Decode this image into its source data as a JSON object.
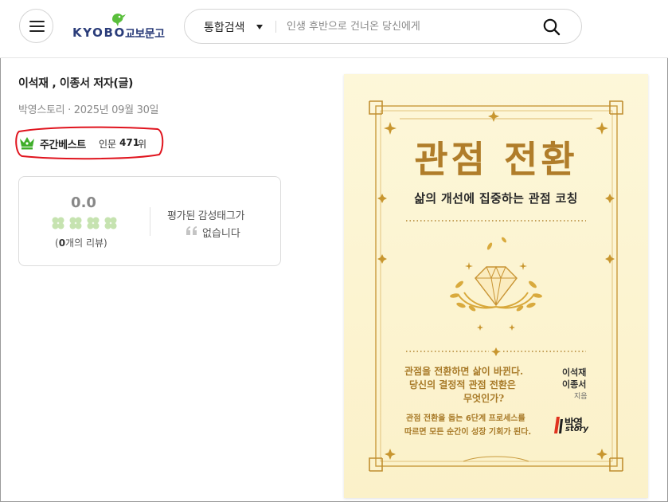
{
  "header": {
    "logo_en": "KYOBO",
    "logo_ko": "교보문고",
    "search_category": "통합검색",
    "search_placeholder": "인생 후반으로 건너온 당신에게",
    "icons": [
      "menu-icon",
      "search-icon",
      "chevron-down-icon"
    ]
  },
  "book": {
    "authors": "이석재 , 이종서 저자(글)",
    "publisher_date": "박영스토리 · 2025년 09월 30일",
    "bestseller": {
      "label": "주간베스트",
      "category": "인문",
      "rank": "471",
      "rank_unit": "위"
    }
  },
  "review": {
    "score": "0.0",
    "clover_count": 4,
    "count_prefix": "(",
    "count": "0",
    "count_suffix": "개의 리뷰)",
    "emotion_line1": "평가된 감성태그가",
    "emotion_line2": "없습니다"
  },
  "cover": {
    "title": "관점 전환",
    "subtitle": "삶의 개선에 집중하는 관점 코칭",
    "question_line1": "관점을 전환하면 삶이 바뀐다.",
    "question_line2": "당신의 결정적 관점 전환은",
    "question_line3": "무엇인가?",
    "desc_line1": "관점 전환을 돕는 6단계 프로세스를",
    "desc_line2": "따르면 모든 순간이 성장 기회가 된다.",
    "author1": "이석재",
    "author2": "이종서",
    "author_role": "지음",
    "publisher_logo_line1": "박영",
    "publisher_logo_line2": "story"
  },
  "colors": {
    "brand_navy": "#2b3d7a",
    "brand_green": "#5abf3c",
    "highlight_red": "#e0141e",
    "cover_gold": "#b07d2a",
    "cover_bg": "#fcf4d0"
  }
}
